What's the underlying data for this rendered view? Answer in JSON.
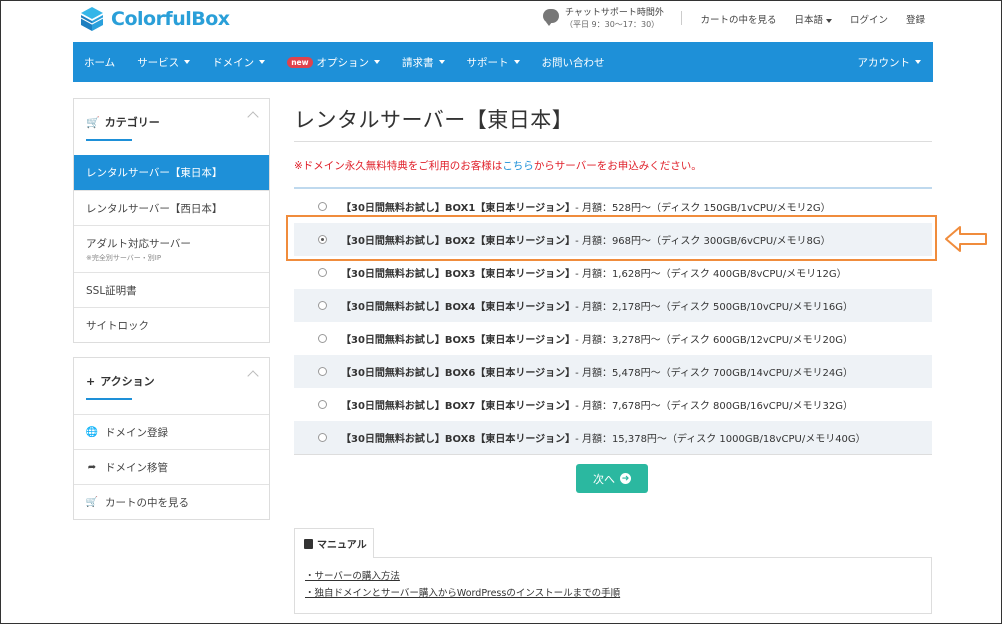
{
  "header": {
    "logo_text": "ColorfulBox",
    "support_title": "チャットサポート時間外",
    "support_hours": "（平日 9：30〜17：30）",
    "links": [
      "カートの中を見る",
      "日本語",
      "ログイン",
      "登録"
    ]
  },
  "nav": {
    "items": [
      {
        "label": "ホーム",
        "caret": false
      },
      {
        "label": "サービス",
        "caret": true
      },
      {
        "label": "ドメイン",
        "caret": true
      },
      {
        "label": "オプション",
        "caret": true,
        "badge": "new"
      },
      {
        "label": "請求書",
        "caret": true
      },
      {
        "label": "サポート",
        "caret": true
      },
      {
        "label": "お問い合わせ",
        "caret": false
      }
    ],
    "account": "アカウント"
  },
  "sidebar": {
    "category_title": "カテゴリー",
    "categories": [
      {
        "label": "レンタルサーバー【東日本】",
        "active": true
      },
      {
        "label": "レンタルサーバー【西日本】",
        "active": false
      },
      {
        "label": "アダルト対応サーバー",
        "note": "※完全別サーバー・別IP",
        "active": false
      },
      {
        "label": "SSL証明書",
        "active": false
      },
      {
        "label": "サイトロック",
        "active": false
      }
    ],
    "action_title": "アクション",
    "actions": [
      {
        "label": "ドメイン登録",
        "icon": "globe-icon"
      },
      {
        "label": "ドメイン移管",
        "icon": "share-icon"
      },
      {
        "label": "カートの中を見る",
        "icon": "cart-icon"
      }
    ]
  },
  "main": {
    "title": "レンタルサーバー【東日本】",
    "notice_before": "※ドメイン永久無料特典をご利用のお客様は",
    "notice_link": "こちら",
    "notice_after": "からサーバーをお申込みください。",
    "plans": [
      {
        "name": "【30日間無料お試し】BOX1【東日本リージョン】",
        "price": " - 月額：528円〜",
        "spec": "（ディスク 150GB/1vCPU/メモリ2G）",
        "checked": false
      },
      {
        "name": "【30日間無料お試し】BOX2【東日本リージョン】",
        "price": " - 月額：968円〜",
        "spec": "（ディスク 300GB/6vCPU/メモリ8G）",
        "checked": true
      },
      {
        "name": "【30日間無料お試し】BOX3【東日本リージョン】",
        "price": " - 月額：1,628円〜",
        "spec": "（ディスク 400GB/8vCPU/メモリ12G）",
        "checked": false
      },
      {
        "name": "【30日間無料お試し】BOX4【東日本リージョン】",
        "price": " - 月額：2,178円〜",
        "spec": "（ディスク 500GB/10vCPU/メモリ16G）",
        "checked": false
      },
      {
        "name": "【30日間無料お試し】BOX5【東日本リージョン】",
        "price": " - 月額：3,278円〜",
        "spec": "（ディスク 600GB/12vCPU/メモリ20G）",
        "checked": false
      },
      {
        "name": "【30日間無料お試し】BOX6【東日本リージョン】",
        "price": " - 月額：5,478円〜",
        "spec": "（ディスク 700GB/14vCPU/メモリ24G）",
        "checked": false
      },
      {
        "name": "【30日間無料お試し】BOX7【東日本リージョン】",
        "price": " - 月額：7,678円〜",
        "spec": "（ディスク 800GB/16vCPU/メモリ32G）",
        "checked": false
      },
      {
        "name": "【30日間無料お試し】BOX8【東日本リージョン】",
        "price": " - 月額：15,378円〜",
        "spec": "（ディスク 1000GB/18vCPU/メモリ40G）",
        "checked": false
      }
    ],
    "next_label": "次へ",
    "manual_tab": "マニュアル",
    "manual_links": [
      "・サーバーの購入方法",
      "・独自ドメインとサーバー購入からWordPressのインストールまでの手順"
    ]
  },
  "colors": {
    "brand_blue": "#1e90d8",
    "next_button": "#2bb8a0",
    "highlight": "#f08c3c",
    "notice_red": "#e0202a"
  }
}
